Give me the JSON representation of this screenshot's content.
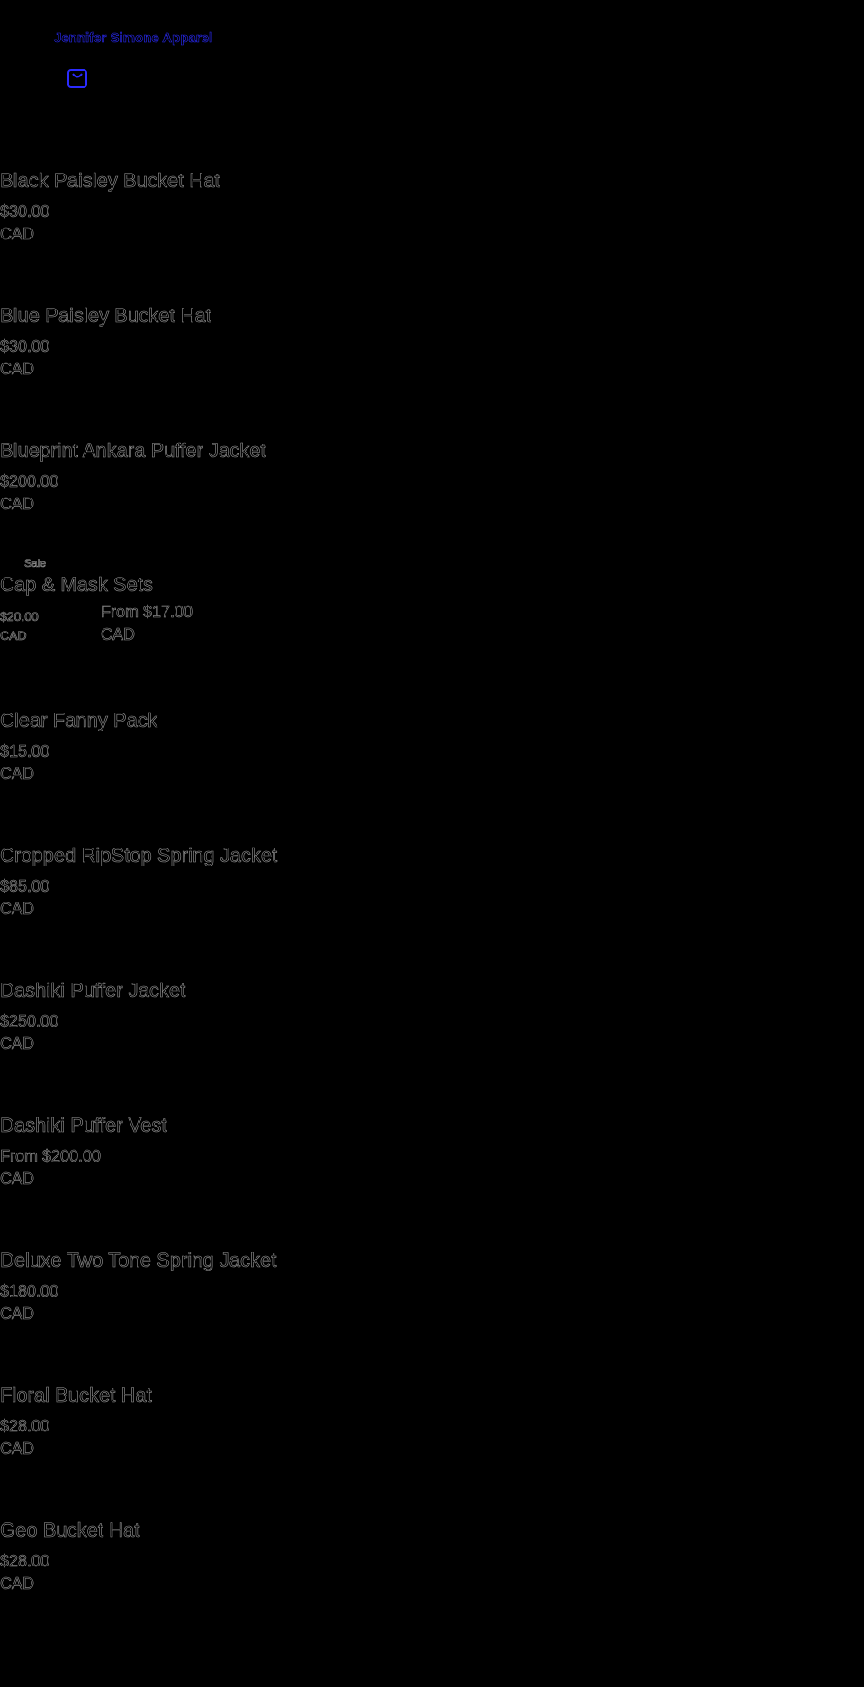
{
  "header": {
    "store_name": "Jennifer Simone Apparel",
    "cart_icon": "shopping-bag-icon",
    "link_color": "#2b2bff"
  },
  "products": [
    {
      "title": "Black Paisley Bucket Hat",
      "price": "$30.00",
      "currency": "CAD"
    },
    {
      "title": "Blue Paisley Bucket Hat",
      "price": "$30.00",
      "currency": "CAD"
    },
    {
      "title": "Blueprint Ankara Puffer Jacket",
      "price": "$200.00",
      "currency": "CAD"
    },
    {
      "badge": "Sale",
      "title": "Cap & Mask Sets",
      "compare_price": "$20.00",
      "compare_currency": "CAD",
      "price": "From $17.00",
      "currency": "CAD"
    },
    {
      "title": "Clear Fanny Pack",
      "price": "$15.00",
      "currency": "CAD"
    },
    {
      "title": "Cropped RipStop Spring Jacket",
      "price": "$85.00",
      "currency": "CAD"
    },
    {
      "title": "Dashiki Puffer Jacket",
      "price": "$250.00",
      "currency": "CAD"
    },
    {
      "title": "Dashiki Puffer Vest",
      "price": "From $200.00",
      "currency": "CAD"
    },
    {
      "title": "Deluxe Two Tone Spring Jacket",
      "price": "$180.00",
      "currency": "CAD"
    },
    {
      "title": "Floral Bucket Hat",
      "price": "$28.00",
      "currency": "CAD"
    },
    {
      "title": "Geo Bucket Hat",
      "price": "$28.00",
      "currency": "CAD"
    }
  ]
}
